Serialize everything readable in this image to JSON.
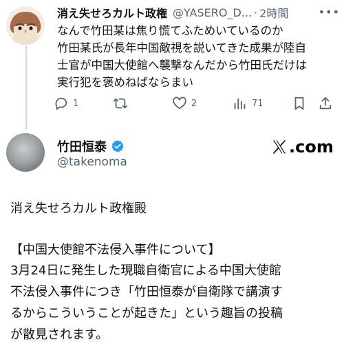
{
  "reply": {
    "display_name": "消え失せろカルト政権",
    "handle": "@YASERO_D...",
    "separator": "·",
    "time": "2時間",
    "text_lines": [
      "なんで竹田某は焦り慌てふためいているのか",
      "竹田某氏が長年中国敵視を説いてきた成果が陸自",
      "士官が中国大使館へ襲撃なんだから竹田氏だけは",
      "実行犯を褒めねばならまい"
    ],
    "actions": {
      "reply_count": "1",
      "retweet_count": "",
      "like_count": "2",
      "view_count": "71"
    }
  },
  "quoted_post": {
    "display_name": "竹田恒泰",
    "handle": "@takenoma",
    "brand_label": ".com",
    "text_lines": [
      "消え失せろカルト政権殿",
      "【中国大使館不法侵入事件について】",
      "3月24日に発生した現職自衛官による中国大使館",
      "不法侵入事件につき「竹田恒泰が自衛隊で講演す",
      "るからこういうことが起きた」という趣旨の投稿",
      "が散見されます。"
    ]
  },
  "colors": {
    "text": "#0f1419",
    "muted": "#536471",
    "verified": "#1d9bf0",
    "thread_line": "#cfd9de"
  },
  "icons": [
    "more-icon",
    "reply-icon",
    "retweet-icon",
    "like-icon",
    "views-icon",
    "bookmark-icon",
    "share-icon",
    "verified-badge-icon",
    "x-logo-icon"
  ]
}
